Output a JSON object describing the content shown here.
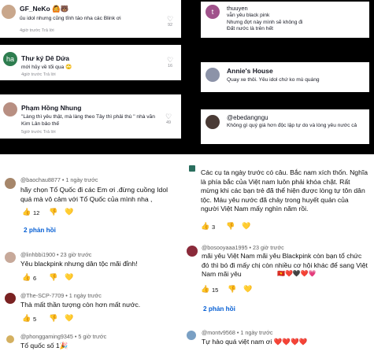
{
  "tiktok": {
    "left_comments": [
      {
        "name": "GF_NeKo",
        "name_suffix": "🙆🐻",
        "text": "ủu idol nhưng cũng tỉnh táo nha các Blink ơi",
        "meta": "4giờ trước    Trả lời",
        "likes": "92"
      },
      {
        "name": "Thư ký Dê Dứa",
        "text": "mới hủy về tối qua 🙄",
        "meta": "4giờ trước    Trả lời",
        "likes": "16"
      },
      {
        "name": "Phạm Hồng Nhung",
        "text": "\"Làng thì yêu thật, mà làng theo Tây thì phải thù \" nhà văn Kim Lân bảo thế",
        "meta": "5giờ trước    Trả lời",
        "likes": "49"
      }
    ],
    "right_comments": [
      {
        "name": "thuuyen",
        "text": "vẫn yêu black pink\nNhưng đợt này mình sẽ không đi\nĐất nước là trên hết",
        "meta": "4giờ trước    Trả lời"
      },
      {
        "name": "Annie's House",
        "text": "Quay xe thôi. Yêu idol chứ ko mù quáng",
        "meta": "4giờ trước    Trả lời"
      },
      {
        "name": "@ebedangngu",
        "text": "Không gì quý giá hơn độc lập tự do và lòng yêu nước cả",
        "meta": "4giờ trước    Trả lời"
      }
    ]
  },
  "youtube": {
    "left": [
      {
        "user": "@baochau8877 • 1 ngày trước",
        "text": "hãy chọn Tổ Quốc đi các Em ơi .đừng cuồng Idol quá mà vô cảm với Tổ Quốc của mình nha ,",
        "likes": "12",
        "replies": "2 phản hồi"
      },
      {
        "user": "@linhbbi1900 • 23 giờ trước",
        "text": "Yêu blackpink nhưng dân tộc mãi đỉnh!",
        "likes": "6"
      },
      {
        "user": "@The-SCP-7709 • 1 ngày trước",
        "text": "Thà mất thần tượng còn hơn mất nước.",
        "likes": "5"
      },
      {
        "user": "@phonggaming9345 • 5 giờ trước",
        "text": "Tổ quốc số 1🎉"
      }
    ],
    "right": [
      {
        "text": "Các cụ ta ngày trước có câu. Bắc nam xích thốn. Nghĩa là phía bắc của Việt nam luôn phải khóa chặt. Rất mừng khi các bạn trẻ đã thể hiện được lòng tự tôn dân tộc. Máu yêu nước đã chảy trong huyết quản của người Việt Nam mấy nghìn năm rồi.",
        "likes": "3"
      },
      {
        "user": "@bosooyaaa1995 • 23 giờ trước",
        "text": "mãi yêu Việt Nam mãi yêu Blackpink còn bạn tổ chức đó thì bó đi mấy chị còn nhiều cơ hội khác để sang Việt Nam mãi yêu",
        "likes": "15",
        "replies": "2 phản hồi"
      },
      {
        "user": "@montv9568 • 1 ngày trước",
        "text": "Tự hào quá việt nam ơi ❤️❤️❤️❤️"
      }
    ]
  }
}
